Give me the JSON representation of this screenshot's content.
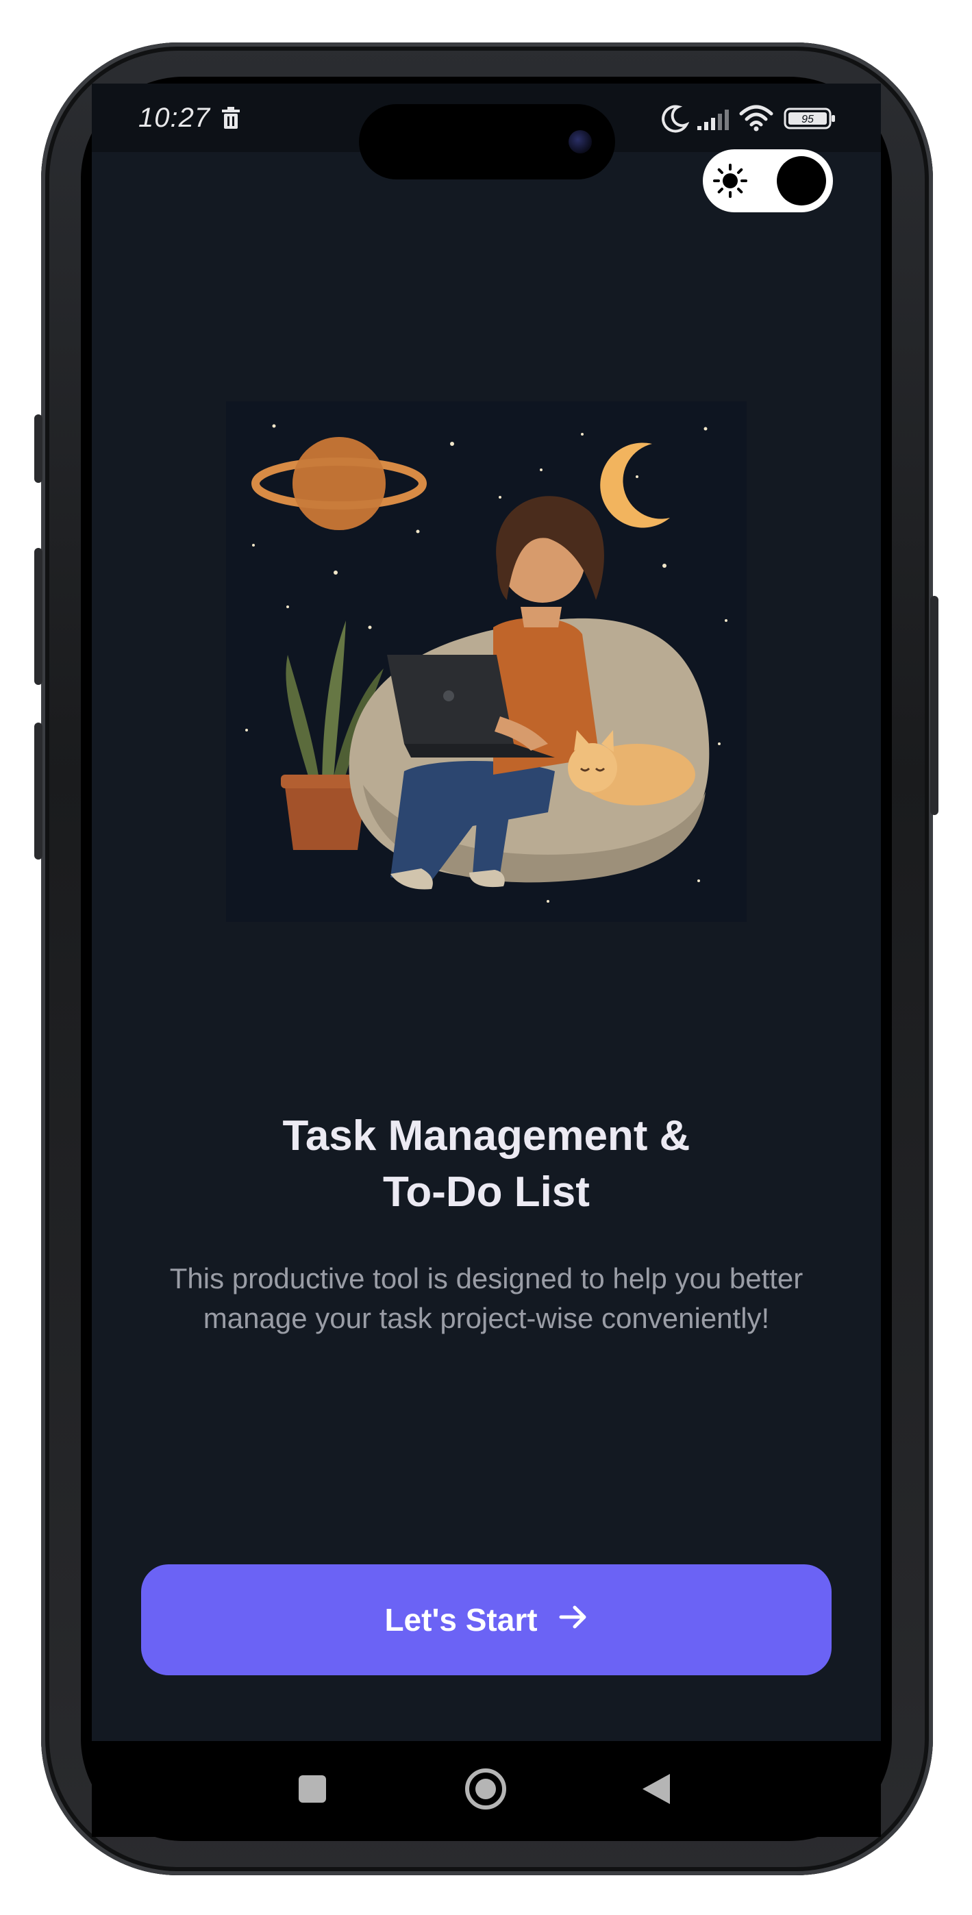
{
  "status_bar": {
    "time": "10:27",
    "battery_level": "95",
    "icons": [
      "trash-icon",
      "moon-icon",
      "signal-icon",
      "wifi-icon",
      "battery-icon"
    ]
  },
  "theme_toggle": {
    "icon": "sun-icon",
    "state": "dark"
  },
  "onboarding": {
    "illustration": "woman-with-laptop-on-beanbag-night-sky",
    "title_line1": "Task Management &",
    "title_line2": "To-Do List",
    "description": "This productive tool is designed to help you better manage your task project-wise conveniently!",
    "cta_label": "Let's Start",
    "cta_icon": "arrow-right-icon"
  },
  "colors": {
    "background": "#131922",
    "primary": "#6b63f5",
    "title": "#eceaf3",
    "description": "#9a9da6"
  },
  "nav_bar": {
    "icons": [
      "recents-square-icon",
      "home-circle-icon",
      "back-triangle-icon"
    ]
  }
}
